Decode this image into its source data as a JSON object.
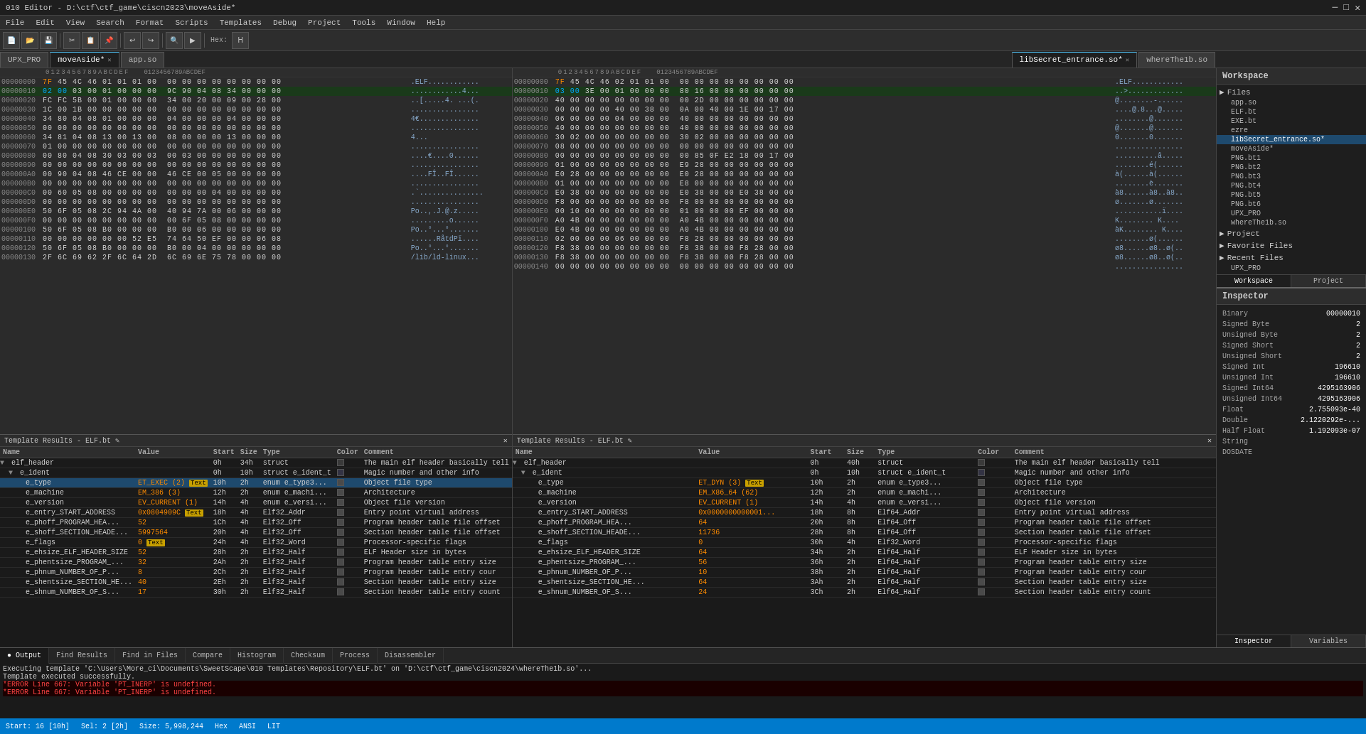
{
  "titlebar": {
    "title": "010 Editor - D:\\ctf\\ctf_game\\ciscn2023\\moveAside*",
    "controls": [
      "─",
      "□",
      "✕"
    ]
  },
  "menubar": {
    "items": [
      "File",
      "Edit",
      "View",
      "Search",
      "Format",
      "Scripts",
      "Templates",
      "Debug",
      "Project",
      "Tools",
      "Window",
      "Help"
    ]
  },
  "tabs": {
    "main": [
      {
        "label": "UPX_PRO",
        "active": false,
        "modified": false
      },
      {
        "label": "moveAside*",
        "active": true,
        "modified": true
      },
      {
        "label": "app.so",
        "active": false,
        "modified": false
      }
    ],
    "right": [
      {
        "label": "libSecret_entrance.so*",
        "active": true,
        "modified": true
      },
      {
        "label": "whereThe1b.so",
        "active": false,
        "modified": false
      }
    ]
  },
  "workspace": {
    "title": "Workspace",
    "sections": {
      "files": {
        "label": "Files",
        "items": [
          {
            "name": "app.so",
            "active": false
          },
          {
            "name": "ELF.bt",
            "active": false
          },
          {
            "name": "EXE.bt",
            "active": false
          },
          {
            "name": "ezre",
            "active": false
          },
          {
            "name": "libSecret_entrance.so*",
            "active": true
          },
          {
            "name": "moveAside*",
            "active": false
          },
          {
            "name": "PNG.bt1",
            "active": false
          },
          {
            "name": "PNG.bt2",
            "active": false
          },
          {
            "name": "PNG.bt3",
            "active": false
          },
          {
            "name": "PNG.bt4",
            "active": false
          },
          {
            "name": "PNG.bt5",
            "active": false
          },
          {
            "name": "PNG.bt6",
            "active": false
          },
          {
            "name": "UPX_PRO",
            "active": false
          },
          {
            "name": "whereThe1b.so",
            "active": false
          }
        ]
      },
      "project": {
        "label": "Project"
      },
      "favoriteFiles": {
        "label": "Favorite Files"
      },
      "recentFiles": {
        "label": "Recent Files",
        "items": [
          {
            "name": "UPX_PRO"
          },
          {
            "name": "..."
          }
        ]
      }
    },
    "bottomTabs": [
      "Workspace",
      "Project"
    ]
  },
  "inspector": {
    "title": "Inspector",
    "rows": [
      {
        "type": "Binary",
        "value": "00000010"
      },
      {
        "type": "Signed Byte",
        "value": "2"
      },
      {
        "type": "Unsigned Byte",
        "value": "2"
      },
      {
        "type": "Signed Short",
        "value": "2"
      },
      {
        "type": "Unsigned Short",
        "value": "2"
      },
      {
        "type": "Signed Int",
        "value": "196610"
      },
      {
        "type": "Unsigned Int",
        "value": "196610"
      },
      {
        "type": "Signed Int64",
        "value": "4295163906"
      },
      {
        "type": "Unsigned Int64",
        "value": "4295163906"
      },
      {
        "type": "Float",
        "value": "2.755093e-40"
      },
      {
        "type": "Double",
        "value": "2.1220292e-..."
      },
      {
        "type": "Half Float",
        "value": "1.192093e-07"
      },
      {
        "type": "String",
        "value": ""
      },
      {
        "type": "DOSDATE",
        "value": ""
      }
    ],
    "bottomTabs": [
      "Inspector",
      "Variables"
    ]
  },
  "leftHex": {
    "ruler": "0123456789ABCDEF",
    "rows": [
      {
        "addr": "000000",
        "bytes": "7F 45 4C 46 01 01 01 00  00 00 00 00 00 00 00 00",
        "chars": ".ELF............"
      },
      {
        "addr": "000010",
        "bytes": "02 00 03 00 01 00 00 00  9C 90 04 08 34 00 00 00",
        "chars": "............4..."
      },
      {
        "addr": "000020",
        "bytes": "FC FC 5B 00 01 00 00 00  34 00 20 00 09 00 28 00",
        "chars": "..[.....4. ...(.",
        "highlight": true
      },
      {
        "addr": "000030",
        "bytes": "1C 00 1B 00 00 00 00 00  00 00 00 00 00 00 00 00",
        "chars": "................"
      },
      {
        "addr": "000040",
        "bytes": "34 80 04 08 01 00 00 00  04 00 00 00 04 00 00 00",
        "chars": "4..............."
      },
      {
        "addr": "000050",
        "bytes": "00 00 00 00 00 00 00 00  00 00 00 00 00 00 00 00",
        "chars": "................"
      },
      {
        "addr": "000060",
        "bytes": "34 81 04 08 13 00 13 00  08 00 00 00 13 00 00 00",
        "chars": "4..............."
      },
      {
        "addr": "000070",
        "bytes": "01 00 00 00 00 00 00 00  00 00 00 00 00 00 00 00",
        "chars": "................"
      },
      {
        "addr": "000080",
        "bytes": "00 80 04 08 30 03 00 03  00 03 00 00 00 00 00 00",
        "chars": "....0..........."
      },
      {
        "addr": "000090",
        "bytes": "00 00 00 00 00 00 00 00  00 00 00 00 00 00 00 00",
        "chars": "................"
      },
      {
        "addr": "0000A0",
        "bytes": "00 90 04 08 46 CE 00 00  46 CE 00 05 00 00 00 00",
        "chars": "....F...F......."
      },
      {
        "addr": "0000B0",
        "bytes": "00 00 00 00 00 00 00 00  00 00 00 00 00 00 00 00",
        "chars": "................"
      },
      {
        "addr": "0000C0",
        "bytes": "00 60 05 08 00 00 00 00  00 00 00 04 00 00 00 00",
        "chars": ".`.............."
      },
      {
        "addr": "0000D0",
        "bytes": "00 00 00 00 00 00 00 00  00 00 00 00 00 00 00 00",
        "chars": "................"
      },
      {
        "addr": "0000E0",
        "bytes": "50 6F 05 08 2C 94 4A 00  40 94 7A 00 06 00 00 00",
        "chars": "Po..,.J.@.z....."
      },
      {
        "addr": "0000F0",
        "bytes": "00 00 00 00 00 00 00 00  00 6F 05 08 00 00 00 00",
        "chars": ".........o......"
      },
      {
        "addr": "000100",
        "bytes": "50 6F 05 08 B0 00 00 00  B0 00 06 00 00 00 00 00",
        "chars": "Po.............."
      },
      {
        "addr": "000110",
        "bytes": "00 00 00 00 00 00 52 E5  74 64 50 EF 00 00 06 08",
        "chars": "......R.tdP....."
      },
      {
        "addr": "000120",
        "bytes": "50 6F 05 08 B0 00 00 00  B0 00 04 00 00 00 00 00",
        "chars": "Po.............."
      },
      {
        "addr": "000130",
        "bytes": "00 2F 6C 69 62 2F 6C 64  2D 6C 69 6E 75",
        "chars": "./lib/ld-linu"
      }
    ]
  },
  "rightHex": {
    "rows": [
      {
        "addr": "0000",
        "bytes": "7F 45 4C 46 02 01 01 00  00 00 00 00 00 00 00 00",
        "chars": ".ELF............"
      },
      {
        "addr": "0010",
        "bytes": "03 00 3E 00 01 00 00 00  80 16 00 00 00 00 00 00",
        "chars": "..>............."
      },
      {
        "addr": "0020",
        "bytes": "40 00 00 00 00 00 00 00  00 2D 00 00 00 00 00 00",
        "chars": "@........-......",
        "highlight": true
      },
      {
        "addr": "0030",
        "bytes": "00 00 00 00 40 00 38 00  0A 00 40 00 1E 00 17 00",
        "chars": "....@.8...@....."
      },
      {
        "addr": "0040",
        "bytes": "06 00 00 00 04 00 00 00  40 00 00 00 00 00 00 00",
        "chars": "........@......."
      },
      {
        "addr": "0050",
        "bytes": "40 00 00 00 00 00 00 00  40 00 00 00 00 00 00 00",
        "chars": "@.......@......."
      },
      {
        "addr": "0060",
        "bytes": "30 02 00 00 00 00 00 00  30 02 00 00 00 00 00 00",
        "chars": "0.......0......."
      },
      {
        "addr": "0070",
        "bytes": "08 00 00 00 00 00 00 00  00 00 00 00 00 00 00 00",
        "chars": "................"
      },
      {
        "addr": "0080",
        "bytes": "00 00 00 00 00 00 00 00  00 85 0F E2 18 00 17 00",
        "chars": "..............â."
      },
      {
        "addr": "0090",
        "bytes": "01 00 00 00 00 00 00 00  E9 28 00 00 00 00 00 00",
        "chars": "........é(......"
      },
      {
        "addr": "00A0",
        "bytes": "E0 28 00 00 00 00 00 00  E0 28 00 00 00 00 00 00",
        "chars": "à(....... (....."
      },
      {
        "addr": "00B0",
        "bytes": "01 00 00 00 00 00 00 00  E8 00 00 00 00 00 00 00",
        "chars": "........è......."
      },
      {
        "addr": "00C0",
        "bytes": "E0 38 00 00 00 00 00 00  E0 38 00 00 E0 38 00 00",
        "chars": "à8.......8..à8.."
      },
      {
        "addr": "00D0",
        "bytes": "F8 00 00 00 00 00 00 00  F8 00 00 00 00 00 00 00",
        "chars": "ø.......ø......."
      },
      {
        "addr": "00E0",
        "bytes": "00 10 00 00 00 00 00 00  01 00 00 00 EF 00 00 00",
        "chars": "...........ï...."
      },
      {
        "addr": "00F0",
        "bytes": "A0 4B 00 00 00 00 00 00  A0 4B 00 00 00 00 00 00",
        "chars": " K........ K...."
      },
      {
        "addr": "0100",
        "bytes": "E0 4B 00 00 00 00 00 00  A0 4B 00 00 00 00 00 00",
        "chars": "àK........ K...."
      },
      {
        "addr": "0110",
        "bytes": "02 00 00 00 06 00 00 00  F8 28 00 00 00 00 00 00",
        "chars": "........ø(......"
      },
      {
        "addr": "0120",
        "bytes": "F8 38 00 00 00 00 00 00  F8 38 00 00 F8 28 00 00",
        "chars": "ø8.......8..ø(.."
      },
      {
        "addr": "0130",
        "bytes": "F8 38 00 00 00 00 00 00  F8 38 00 00 F8 28 00 00",
        "chars": "ø8.......8..ø(.."
      },
      {
        "addr": "0140",
        "bytes": "00 00 00 00 00 00 00 00  00 00 00 00 00 00 00 00",
        "chars": "................"
      }
    ]
  },
  "templateLeft": {
    "title": "Template Results - ELF.bt",
    "columns": [
      "Name",
      "Value",
      "Start",
      "Size",
      "Type",
      "Color",
      "Comment"
    ],
    "rows": [
      {
        "indent": 0,
        "expand": true,
        "name": "elf_header",
        "value": "",
        "start": "0h",
        "size": "34h",
        "type": "struct",
        "comment": "The main elf header basically tell"
      },
      {
        "indent": 1,
        "expand": true,
        "name": "e_ident",
        "value": "",
        "start": "0h",
        "size": "10h",
        "type": "struct e_ident_t",
        "comment": "Magic number and other info"
      },
      {
        "indent": 2,
        "expand": false,
        "name": "e_type",
        "value": "ET_EXEC (2)",
        "start": "10h",
        "size": "2h",
        "type": "enum e_type3...",
        "hasText": true,
        "comment": "Object file type",
        "selected": true
      },
      {
        "indent": 2,
        "expand": false,
        "name": "e_machine",
        "value": "EM_386 (3)",
        "start": "12h",
        "size": "2h",
        "type": "enum e_machi...",
        "comment": "Architecture"
      },
      {
        "indent": 2,
        "expand": false,
        "name": "e_version",
        "value": "EV_CURRENT (1)",
        "start": "14h",
        "size": "4h",
        "type": "enum e_versi...",
        "comment": "Object file version"
      },
      {
        "indent": 2,
        "expand": false,
        "name": "e_entry_START_ADDRESS",
        "value": "0x0804909C",
        "start": "18h",
        "size": "4h",
        "type": "Elf32_Addr",
        "hasText": true,
        "comment": "Entry point virtual address"
      },
      {
        "indent": 2,
        "expand": false,
        "name": "e_phoff_PROGRAM_HEA...",
        "value": "52",
        "start": "1Ch",
        "size": "4h",
        "type": "Elf32_Off",
        "comment": "Program header table file offset"
      },
      {
        "indent": 2,
        "expand": false,
        "name": "e_shoff_SECTION_HEADE...",
        "value": "5997564",
        "start": "20h",
        "size": "4h",
        "type": "Elf32_Off",
        "comment": "Section header table file offset"
      },
      {
        "indent": 2,
        "expand": false,
        "name": "e_flags",
        "value": "0",
        "start": "24h",
        "size": "4h",
        "type": "Elf32_Word",
        "hasText": true,
        "comment": "Processor-specific flags"
      },
      {
        "indent": 2,
        "expand": false,
        "name": "e_ehsize_ELF_HEADER_SIZE",
        "value": "52",
        "start": "28h",
        "size": "2h",
        "type": "Elf32_Half",
        "comment": "ELF Header size in bytes"
      },
      {
        "indent": 2,
        "expand": false,
        "name": "e_phentsize_PROGRAM_...",
        "value": "32",
        "start": "2Ah",
        "size": "2h",
        "type": "Elf32_Half",
        "comment": "Program header table entry size"
      },
      {
        "indent": 2,
        "expand": false,
        "name": "e_phnum_NUMBER_OF_P...",
        "value": "8",
        "start": "2Ch",
        "size": "2h",
        "type": "Elf32_Half",
        "comment": "Program header table entry cour"
      },
      {
        "indent": 2,
        "expand": false,
        "name": "e_shentsize_SECTION_HE...",
        "value": "40",
        "start": "2Eh",
        "size": "2h",
        "type": "Elf32_Half",
        "comment": "Section header table entry size"
      },
      {
        "indent": 2,
        "expand": false,
        "name": "e_shnum_NUMBER_OF_S...",
        "value": "17",
        "start": "30h",
        "size": "2h",
        "type": "Elf32_Half",
        "comment": "Section header table entry count"
      }
    ]
  },
  "templateRight": {
    "title": "Template Results - ELF.bt",
    "columns": [
      "Name",
      "Value",
      "Start",
      "Size",
      "Type",
      "Color",
      "Comment"
    ],
    "rows": [
      {
        "indent": 0,
        "expand": true,
        "name": "elf_header",
        "value": "",
        "start": "0h",
        "size": "40h",
        "type": "struct",
        "comment": "The main elf header basically tell"
      },
      {
        "indent": 1,
        "expand": true,
        "name": "e_ident",
        "value": "",
        "start": "0h",
        "size": "10h",
        "type": "struct e_ident_t",
        "comment": "Magic number and other info"
      },
      {
        "indent": 2,
        "expand": false,
        "name": "e_type",
        "value": "ET_DYN (3)",
        "start": "10h",
        "size": "2h",
        "type": "enum e_type3...",
        "hasText": true,
        "comment": "Object file type",
        "selected": false
      },
      {
        "indent": 2,
        "expand": false,
        "name": "e_machine",
        "value": "EM_X86_64 (62)",
        "start": "12h",
        "size": "2h",
        "type": "enum e_machi...",
        "comment": "Architecture"
      },
      {
        "indent": 2,
        "expand": false,
        "name": "e_version",
        "value": "EV_CURRENT (1)",
        "start": "14h",
        "size": "4h",
        "type": "enum e_versi...",
        "comment": "Object file version"
      },
      {
        "indent": 2,
        "expand": false,
        "name": "e_entry_START_ADDRESS",
        "value": "0x0000000000001...",
        "start": "18h",
        "size": "8h",
        "type": "Elf64_Addr",
        "hasText": false,
        "comment": "Entry point virtual address"
      },
      {
        "indent": 2,
        "expand": false,
        "name": "e_phoff_PROGRAM_HEA...",
        "value": "64",
        "start": "20h",
        "size": "8h",
        "type": "Elf64_Off",
        "comment": "Program header table file offset"
      },
      {
        "indent": 2,
        "expand": false,
        "name": "e_shoff_SECTION_HEADE...",
        "value": "11736",
        "start": "28h",
        "size": "8h",
        "type": "Elf64_Off",
        "comment": "Section header table file offset"
      },
      {
        "indent": 2,
        "expand": false,
        "name": "e_flags",
        "value": "0",
        "start": "30h",
        "size": "4h",
        "type": "Elf32_Word",
        "hasText": false,
        "comment": "Processor-specific flags"
      },
      {
        "indent": 2,
        "expand": false,
        "name": "e_ehsize_ELF_HEADER_SIZE",
        "value": "64",
        "start": "34h",
        "size": "2h",
        "type": "Elf64_Half",
        "comment": "ELF Header size in bytes"
      },
      {
        "indent": 2,
        "expand": false,
        "name": "e_phentsize_PROGRAM_...",
        "value": "56",
        "start": "36h",
        "size": "2h",
        "type": "Elf64_Half",
        "comment": "Program header table entry size"
      },
      {
        "indent": 2,
        "expand": false,
        "name": "e_phnum_NUMBER_OF_P...",
        "value": "10",
        "start": "38h",
        "size": "2h",
        "type": "Elf64_Half",
        "comment": "Program header table entry cour"
      },
      {
        "indent": 2,
        "expand": false,
        "name": "e_shentsize_SECTION_HE...",
        "value": "64",
        "start": "3Ah",
        "size": "2h",
        "type": "Elf64_Half",
        "comment": "Section header table entry size"
      },
      {
        "indent": 2,
        "expand": false,
        "name": "e_shnum_NUMBER_OF_S...",
        "value": "24",
        "start": "3Ch",
        "size": "2h",
        "type": "Elf64_Half",
        "comment": "Section header table entry count"
      }
    ]
  },
  "output": {
    "tabs": [
      "Output",
      "Find Results",
      "Find in Files",
      "Compare",
      "Histogram",
      "Checksum",
      "Process",
      "Disassembler"
    ],
    "lines": [
      {
        "type": "normal",
        "text": "Executing template 'C:\\Users\\More_ci\\Documents\\SweetScape\\010 Templates\\Repository\\ELF.bt' on 'D:\\ctf\\ctf_game\\ciscn2024\\whereThe1b.so'..."
      },
      {
        "type": "normal",
        "text": "Template executed successfully."
      },
      {
        "type": "error",
        "text": "*ERROR Line 667: Variable 'PT_INERP' is undefined."
      },
      {
        "type": "error",
        "text": "*ERROR Line 667: Variable 'PT_INERP' is undefined."
      }
    ]
  },
  "statusbar": {
    "start": "Start: 16 [10h]",
    "sel": "Sel: 2 [2h]",
    "size": "Size: 5,998,244",
    "mode": "Hex",
    "encoding": "ANSI",
    "bits": "LIT"
  }
}
